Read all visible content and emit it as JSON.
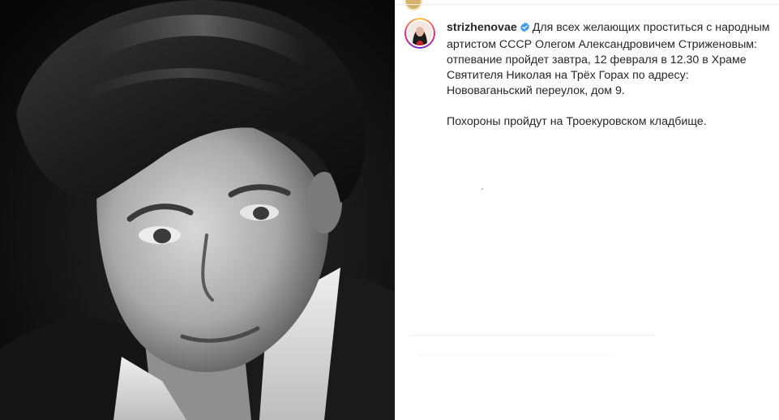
{
  "post": {
    "photo_description_icon": "portrait-photo",
    "author": {
      "username": "strizhenovae",
      "verified_icon": "verified-badge-icon",
      "verified_color": "#3897f0"
    },
    "caption_paragraph_1": "Для всех желающих проститься с народным артистом СССР Олегом Александровичем Стриженовым: отпевание пройдет завтра, 12 февраля в 12.30 в Храме Святителя Николая на Трёх Горах по адресу: Нововаганьский переулок, дом 9.",
    "caption_paragraph_2": "Похороны пройдут на Троекуровском кладбище."
  },
  "colors": {
    "text": "#262626",
    "background": "#ffffff",
    "photo_background": "#0e0e0e"
  }
}
